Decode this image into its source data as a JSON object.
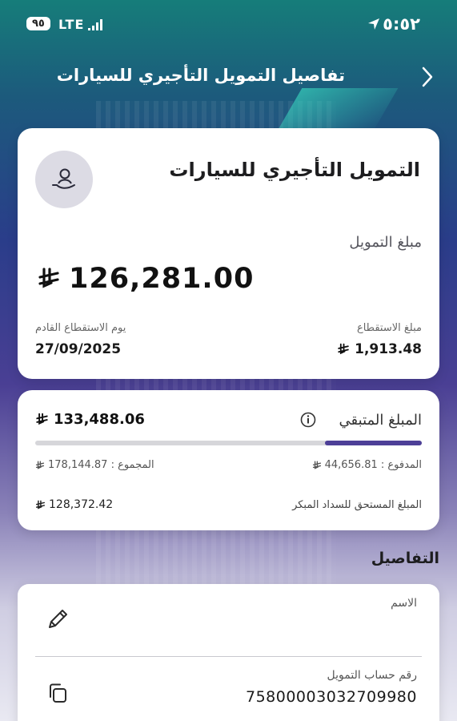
{
  "status_bar": {
    "time": "٥:٥٢",
    "network": "LTE",
    "battery": "٩٥"
  },
  "header": {
    "title": "تفاصيل التمويل التأجيري للسيارات",
    "back_icon": "chevron-right-icon"
  },
  "summary": {
    "product_title": "التمويل التأجيري للسيارات",
    "avatar_icon": "hand-user-icon",
    "financing_label": "مبلغ التمويل",
    "financing_amount": "126,281.00",
    "next_deduction_label": "يوم الاستقطاع القادم",
    "next_deduction_date": "27/09/2025",
    "deduction_label": "مبلغ الاستقطاع",
    "deduction_amount": "1,913.48"
  },
  "balance": {
    "remaining_label": "المبلغ المتبقي",
    "remaining_amount": "133,488.06",
    "paid_text": "المدفوع : 44,656.81",
    "total_text": "المجموع : 178,144.87",
    "paid_fraction": 0.25,
    "early_settlement_label": "المبلغ المستحق للسداد المبكر",
    "early_settlement_amount": "128,372.42"
  },
  "details": {
    "section_title": "التفاصيل",
    "name_label": "الاسم",
    "account_label": "رقم حساب التمويل",
    "account_number": "7580000303270998​0"
  },
  "colors": {
    "accent": "#4d3f97",
    "card_bg": "#ffffff",
    "progress_track": "#d6d6da"
  }
}
